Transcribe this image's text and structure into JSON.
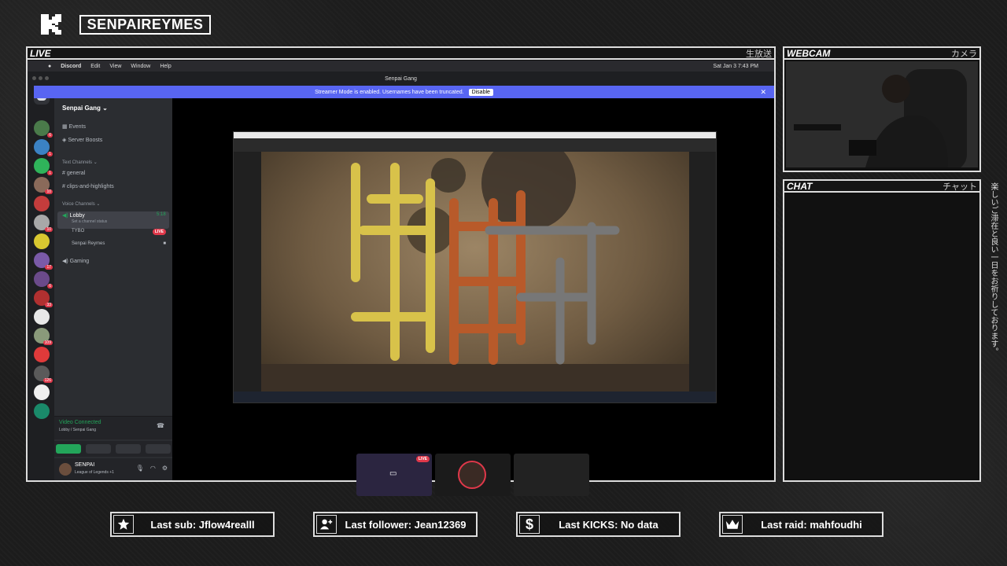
{
  "channel": {
    "name": "SENPAIREYMES",
    "logo": "kick-k-logo"
  },
  "panels": {
    "live": {
      "title": "LIVE",
      "jp": "生放送"
    },
    "webcam": {
      "title": "WEBCAM",
      "jp": "カメラ"
    },
    "chat": {
      "title": "CHAT",
      "jp": "チャット"
    }
  },
  "side_text": "楽しいご滞在と良い一日をお祈りしております。",
  "mac_menu": {
    "items": [
      "Discord",
      "Edit",
      "View",
      "Window",
      "Help"
    ],
    "clock": "Sat Jan 3  7:43 PM"
  },
  "discord": {
    "window_title": "Senpai Gang",
    "streamer_banner": "Streamer Mode is enabled. Usernames have been truncated.",
    "disable_label": "Disable",
    "server_name": "Senpai Gang",
    "events": "Events",
    "boosts": "Server Boosts",
    "text_category": "Text Channels",
    "text_channels": [
      "general",
      "clips-and-highlights"
    ],
    "voice_category": "Voice Channels",
    "voice_channel": "Lobby",
    "voice_time": "5:18",
    "voice_status": "Set a channel status",
    "voice_users": [
      {
        "name": "TYBO",
        "live": "LIVE"
      },
      {
        "name": "Senpai Reymes",
        "live": ""
      }
    ],
    "gaming_channel": "Gaming",
    "video_status": "Video Connected",
    "video_location": "Lobby / Senpai Gang",
    "user_name": "SENPAI",
    "user_activity": "League of Legends +1",
    "guild_badges": [
      "6",
      "1",
      "1",
      "10",
      "",
      "10",
      "",
      "17",
      "6",
      "33",
      "",
      "109",
      "",
      "126",
      "",
      ""
    ],
    "thumb_live": "LIVE"
  },
  "stats": [
    {
      "icon": "star-icon",
      "label": "Last sub: Jflow4realll"
    },
    {
      "icon": "user-plus-icon",
      "label": "Last follower: Jean12369"
    },
    {
      "icon": "dollar-icon",
      "label": "Last KICKS: No data"
    },
    {
      "icon": "crown-icon",
      "label": "Last raid: mahfoudhi"
    }
  ]
}
